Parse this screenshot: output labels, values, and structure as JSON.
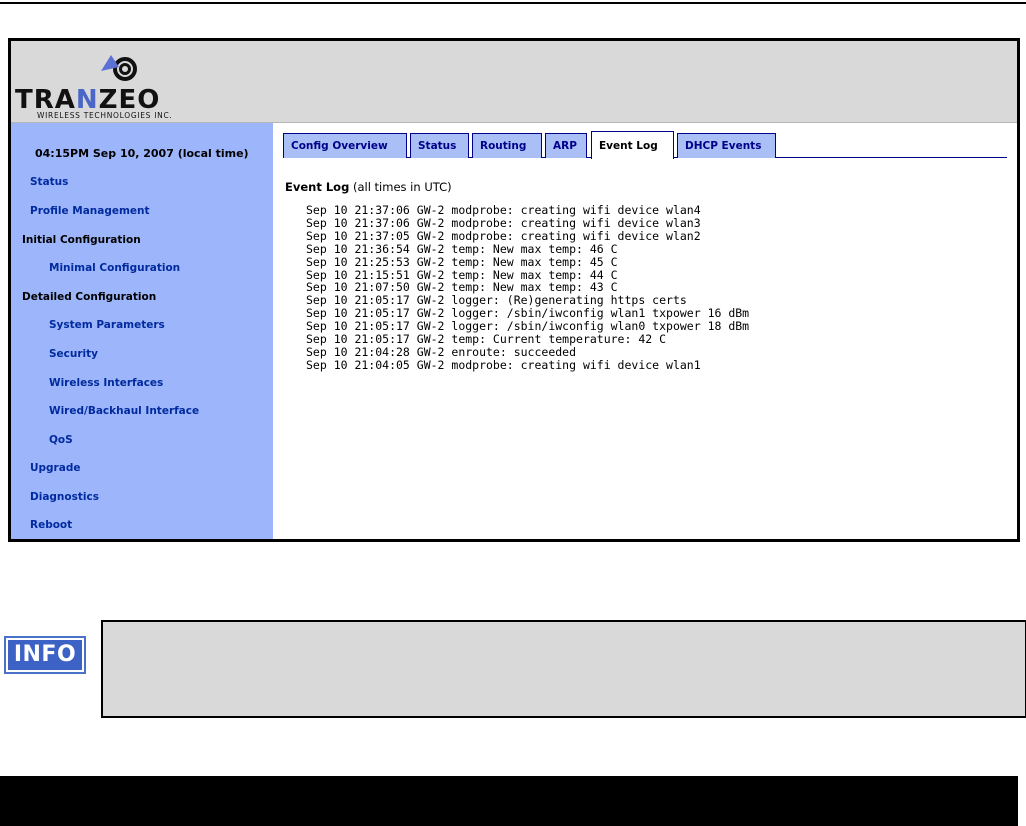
{
  "brand": {
    "name_prefix": "TRA",
    "name_accent": "N",
    "name_suffix": "ZEO",
    "tagline": "WIRELESS TECHNOLOGIES INC."
  },
  "sidebar": {
    "clock": "04:15PM Sep 10, 2007 (local time)",
    "items": [
      {
        "label": "Status"
      },
      {
        "label": "Profile Management"
      },
      {
        "label": "Initial Configuration"
      },
      {
        "label": "Minimal Configuration"
      },
      {
        "label": "Detailed Configuration"
      },
      {
        "label": "System Parameters"
      },
      {
        "label": "Security"
      },
      {
        "label": "Wireless Interfaces"
      },
      {
        "label": "Wired/Backhaul Interface"
      },
      {
        "label": "QoS"
      },
      {
        "label": "Upgrade"
      },
      {
        "label": "Diagnostics"
      },
      {
        "label": "Reboot"
      }
    ]
  },
  "tabs": [
    {
      "label": "Config Overview"
    },
    {
      "label": "Status"
    },
    {
      "label": "Routing"
    },
    {
      "label": "ARP"
    },
    {
      "label": "Event Log"
    },
    {
      "label": "DHCP Events"
    }
  ],
  "active_tab": "Event Log",
  "event_log": {
    "title": "Event Log",
    "subtitle": "(all times in UTC)",
    "lines": [
      "Sep 10 21:37:06 GW-2 modprobe: creating wifi device wlan4",
      "Sep 10 21:37:06 GW-2 modprobe: creating wifi device wlan3",
      "Sep 10 21:37:05 GW-2 modprobe: creating wifi device wlan2",
      "Sep 10 21:36:54 GW-2 temp: New max temp: 46 C",
      "Sep 10 21:25:53 GW-2 temp: New max temp: 45 C",
      "Sep 10 21:15:51 GW-2 temp: New max temp: 44 C",
      "Sep 10 21:07:50 GW-2 temp: New max temp: 43 C",
      "Sep 10 21:05:17 GW-2 logger: (Re)generating https certs",
      "Sep 10 21:05:17 GW-2 logger: /sbin/iwconfig wlan1 txpower 16 dBm",
      "Sep 10 21:05:17 GW-2 logger: /sbin/iwconfig wlan0 txpower 18 dBm",
      "Sep 10 21:05:17 GW-2 temp: Current temperature: 42 C",
      "Sep 10 21:04:28 GW-2 enroute: succeeded",
      "Sep 10 21:04:05 GW-2 modprobe: creating wifi device wlan1"
    ]
  },
  "info": {
    "badge": "INFO"
  },
  "colors": {
    "sidebar_bg": "#9db6fb",
    "header_bg": "#d9d9d9",
    "link": "#002a9e",
    "tab_bg": "#a9bff5",
    "tab_border": "#00008b",
    "brand_accent": "#4a66c6"
  }
}
